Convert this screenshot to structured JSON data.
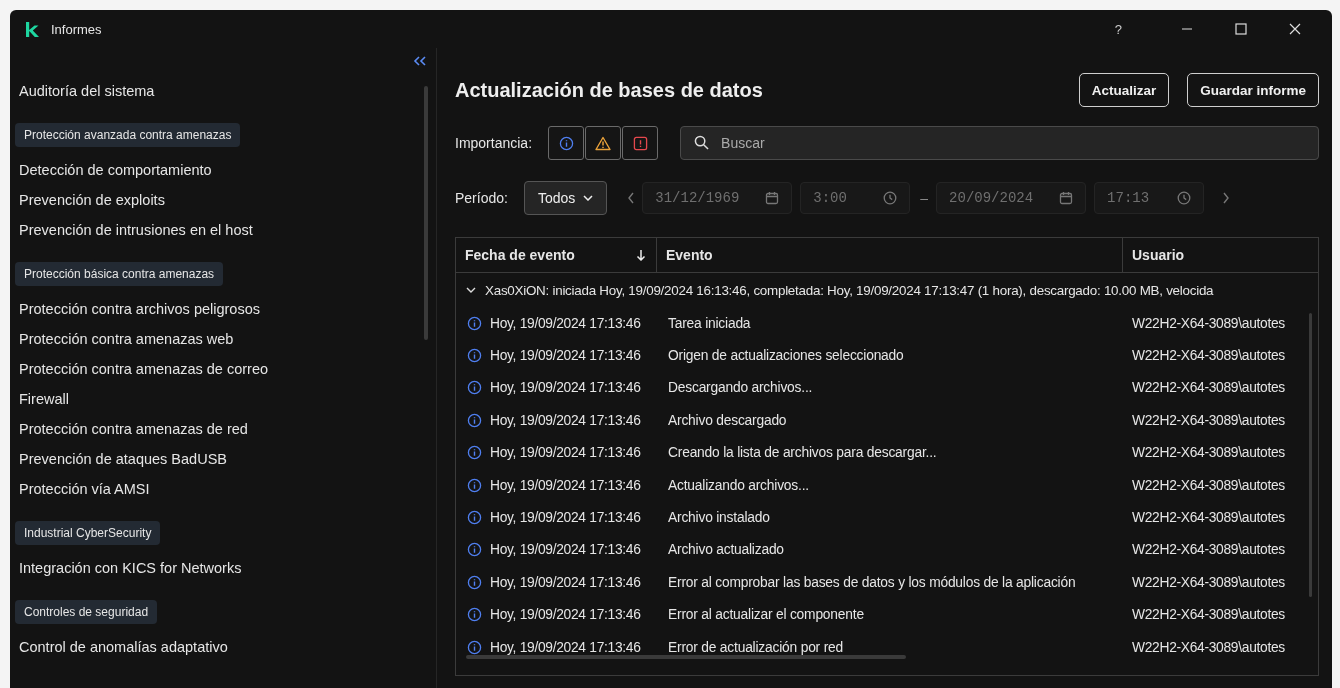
{
  "window": {
    "title": "Informes",
    "controls": [
      "?"
    ]
  },
  "sidebar": {
    "items": [
      {
        "kind": "item",
        "label": "Auditoría del sistema"
      },
      {
        "kind": "group",
        "label": "Protección avanzada contra amenazas"
      },
      {
        "kind": "item",
        "label": "Detección de comportamiento"
      },
      {
        "kind": "item",
        "label": "Prevención de exploits"
      },
      {
        "kind": "item",
        "label": "Prevención de intrusiones en el host"
      },
      {
        "kind": "group",
        "label": "Protección básica contra amenazas"
      },
      {
        "kind": "item",
        "label": "Protección contra archivos peligrosos"
      },
      {
        "kind": "item",
        "label": "Protección contra amenazas web"
      },
      {
        "kind": "item",
        "label": "Protección contra amenazas de correo"
      },
      {
        "kind": "item",
        "label": "Firewall"
      },
      {
        "kind": "item",
        "label": "Protección contra amenazas de red"
      },
      {
        "kind": "item",
        "label": "Prevención de ataques BadUSB"
      },
      {
        "kind": "item",
        "label": "Protección vía AMSI"
      },
      {
        "kind": "group",
        "label": "Industrial CyberSecurity"
      },
      {
        "kind": "item",
        "label": "Integración con KICS for Networks"
      },
      {
        "kind": "group",
        "label": "Controles de seguridad"
      },
      {
        "kind": "item",
        "label": "Control de anomalías adaptativo"
      }
    ]
  },
  "report": {
    "title": "Actualización de bases de datos",
    "buttons": [
      "Actualizar",
      "Guardar informe"
    ],
    "importance": {
      "label": "Importancia:",
      "filters": [
        {
          "kind": "info",
          "selected": true
        },
        {
          "kind": "warning",
          "selected": true
        },
        {
          "kind": "error",
          "selected": true
        }
      ]
    },
    "search": {
      "placeholder": "Buscar"
    },
    "period": {
      "label": "Período:",
      "value": "Todos",
      "from_date": "31/12/1969",
      "from_time": "3:00",
      "separator": "–",
      "to_date": "20/09/2024",
      "to_time": "17:13"
    },
    "table": {
      "columns": [
        {
          "label": "Fecha de evento",
          "sorted": true
        },
        {
          "label": "Evento",
          "sorted": false
        },
        {
          "label": "Usuario",
          "sorted": false
        }
      ],
      "group": {
        "expanded": true,
        "label": "Xas0XiON: iniciada Hoy, 19/09/2024 16:13:46, completada: Hoy, 19/09/2024 17:13:47 (1 hora), descargado: 10.00 MB, velocida"
      },
      "rows": [
        {
          "kind": "info",
          "date": "Hoy, 19/09/2024 17:13:46",
          "event": "Tarea iniciada",
          "user": "W22H2-X64-3089\\autotes"
        },
        {
          "kind": "info",
          "date": "Hoy, 19/09/2024 17:13:46",
          "event": "Origen de actualizaciones seleccionado",
          "user": "W22H2-X64-3089\\autotes"
        },
        {
          "kind": "info",
          "date": "Hoy, 19/09/2024 17:13:46",
          "event": "Descargando archivos...",
          "user": "W22H2-X64-3089\\autotes"
        },
        {
          "kind": "info",
          "date": "Hoy, 19/09/2024 17:13:46",
          "event": "Archivo descargado",
          "user": "W22H2-X64-3089\\autotes"
        },
        {
          "kind": "info",
          "date": "Hoy, 19/09/2024 17:13:46",
          "event": "Creando la lista de archivos para descargar...",
          "user": "W22H2-X64-3089\\autotes"
        },
        {
          "kind": "info",
          "date": "Hoy, 19/09/2024 17:13:46",
          "event": "Actualizando archivos...",
          "user": "W22H2-X64-3089\\autotes"
        },
        {
          "kind": "info",
          "date": "Hoy, 19/09/2024 17:13:46",
          "event": "Archivo instalado",
          "user": "W22H2-X64-3089\\autotes"
        },
        {
          "kind": "info",
          "date": "Hoy, 19/09/2024 17:13:46",
          "event": "Archivo actualizado",
          "user": "W22H2-X64-3089\\autotes"
        },
        {
          "kind": "info",
          "date": "Hoy, 19/09/2024 17:13:46",
          "event": "Error al comprobar las bases de datos y los módulos de la aplicación",
          "user": "W22H2-X64-3089\\autotes"
        },
        {
          "kind": "info",
          "date": "Hoy, 19/09/2024 17:13:46",
          "event": "Error al actualizar el componente",
          "user": "W22H2-X64-3089\\autotes"
        },
        {
          "kind": "info",
          "date": "Hoy, 19/09/2024 17:13:46",
          "event": "Error de actualización por red",
          "user": "W22H2-X64-3089\\autotes"
        }
      ]
    }
  }
}
